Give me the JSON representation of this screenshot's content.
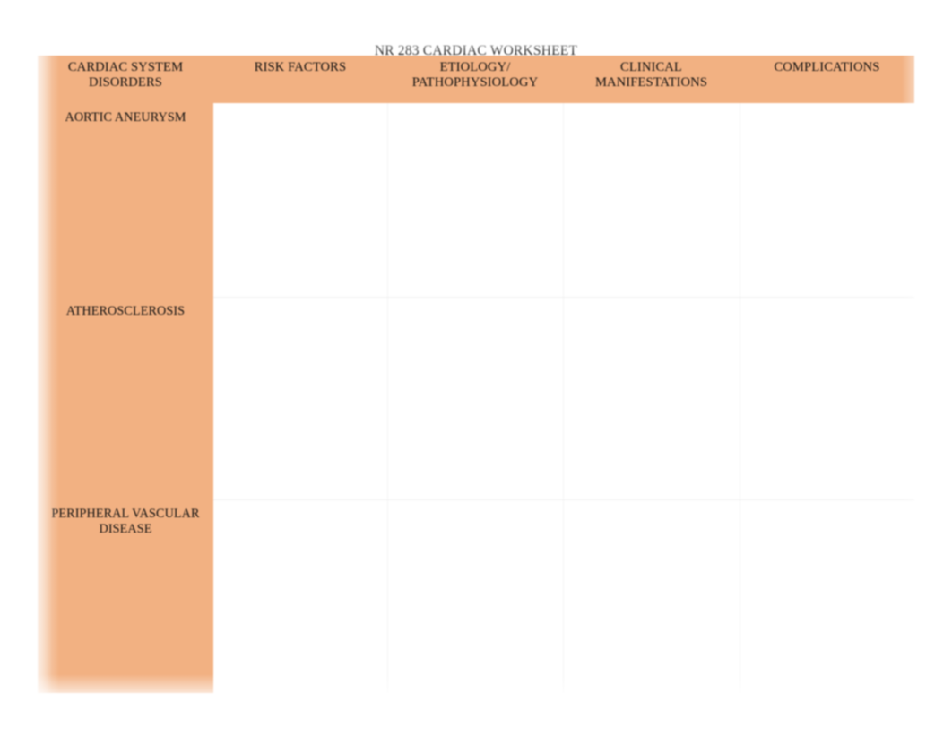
{
  "document": {
    "title": "NR 283 CARDIAC WORKSHEET",
    "background_color": "#ffffff",
    "header_fill_color": "#f2b182",
    "row_label_fill_color": "#f2b182",
    "grid_line_color": "#f2f2f2",
    "text_color": "#0e0e0e"
  },
  "table": {
    "columns": [
      {
        "id": "disorders",
        "header": "CARDIAC SYSTEM DISORDERS"
      },
      {
        "id": "risk",
        "header": "RISK FACTORS"
      },
      {
        "id": "etiology",
        "header": "ETIOLOGY/ PATHOPHYSIOLOGY"
      },
      {
        "id": "clinical",
        "header": "CLINICAL MANIFESTATIONS"
      },
      {
        "id": "complications",
        "header": "COMPLICATIONS"
      }
    ],
    "header_lines": {
      "col1": "CARDIAC SYSTEM DISORDERS",
      "col2": "RISK FACTORS",
      "col3_line1": "ETIOLOGY/",
      "col3_line2": "PATHOPHYSIOLOGY",
      "col4": "CLINICAL MANIFESTATIONS",
      "col5": "COMPLICATIONS"
    },
    "rows": [
      {
        "label": "AORTIC ANEURYSM",
        "risk": "",
        "etiology": "",
        "clinical": "",
        "complications": ""
      },
      {
        "label": "ATHEROSCLEROSIS",
        "risk": "",
        "etiology": "",
        "clinical": "",
        "complications": ""
      },
      {
        "label_line1": "PERIPHERAL VASCULAR",
        "label_line2": "DISEASE",
        "label": "PERIPHERAL VASCULAR DISEASE",
        "risk": "",
        "etiology": "",
        "clinical": "",
        "complications": ""
      }
    ]
  }
}
